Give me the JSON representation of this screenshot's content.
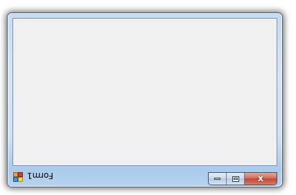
{
  "window": {
    "title": "Form1",
    "icon": "winforms-app-icon"
  },
  "caption_buttons": {
    "minimize_icon": "minimize-icon",
    "maximize_icon": "maximize-icon",
    "close_icon": "close-icon",
    "close_glyph": "x"
  },
  "colors": {
    "client_background": "#f0f0f0",
    "frame": "#cfe3f5",
    "close_button": "#c24632"
  }
}
